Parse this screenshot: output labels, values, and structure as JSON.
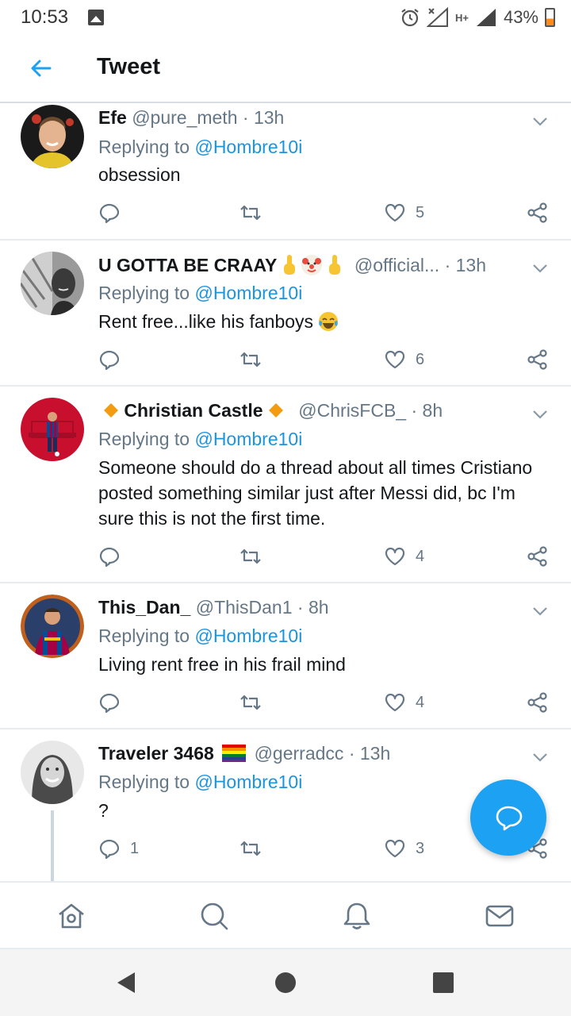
{
  "status_bar": {
    "time": "10:53",
    "battery": "43%",
    "network": "H+"
  },
  "header": {
    "title": "Tweet"
  },
  "tweets": [
    {
      "name": "Efe",
      "handle": "@pure_meth",
      "time": "13h",
      "replying_prefix": "Replying to",
      "replying_to": "@Hombre10i",
      "text": "obsession",
      "replies": "",
      "likes": "5"
    },
    {
      "name": "U GOTTA BE CRAAY",
      "handle": "@official...",
      "time": "13h",
      "replying_prefix": "Replying to",
      "replying_to": "@Hombre10i",
      "text": "Rent free...like his fanboys",
      "replies": "",
      "likes": "6"
    },
    {
      "name": "Christian Castle",
      "handle": "@ChrisFCB_",
      "time": "8h",
      "replying_prefix": "Replying to",
      "replying_to": "@Hombre10i",
      "text": "Someone should do a thread about all times Cristiano posted something similar just after Messi did, bc I'm sure this is not the first time.",
      "replies": "",
      "likes": "4"
    },
    {
      "name": "This_Dan_",
      "handle": "@ThisDan1",
      "time": "8h",
      "replying_prefix": "Replying to",
      "replying_to": "@Hombre10i",
      "text": "Living rent free in his frail mind",
      "replies": "",
      "likes": "4"
    },
    {
      "name": "Traveler 3468",
      "handle": "@gerradcc",
      "time": "13h",
      "replying_prefix": "Replying to",
      "replying_to": "@Hombre10i",
      "text": "?",
      "replies": "1",
      "likes": "3"
    }
  ],
  "colors": {
    "accent": "#1da1f2",
    "link": "#1b95e0",
    "muted": "#657786"
  },
  "icons": {
    "back": "arrow-left-icon",
    "chevron": "chevron-down-icon",
    "reply": "reply-icon",
    "retweet": "retweet-icon",
    "like": "heart-icon",
    "share": "share-icon",
    "compose": "compose-reply-icon",
    "home": "home-icon",
    "search": "search-icon",
    "notifications": "bell-icon",
    "messages": "mail-icon"
  }
}
